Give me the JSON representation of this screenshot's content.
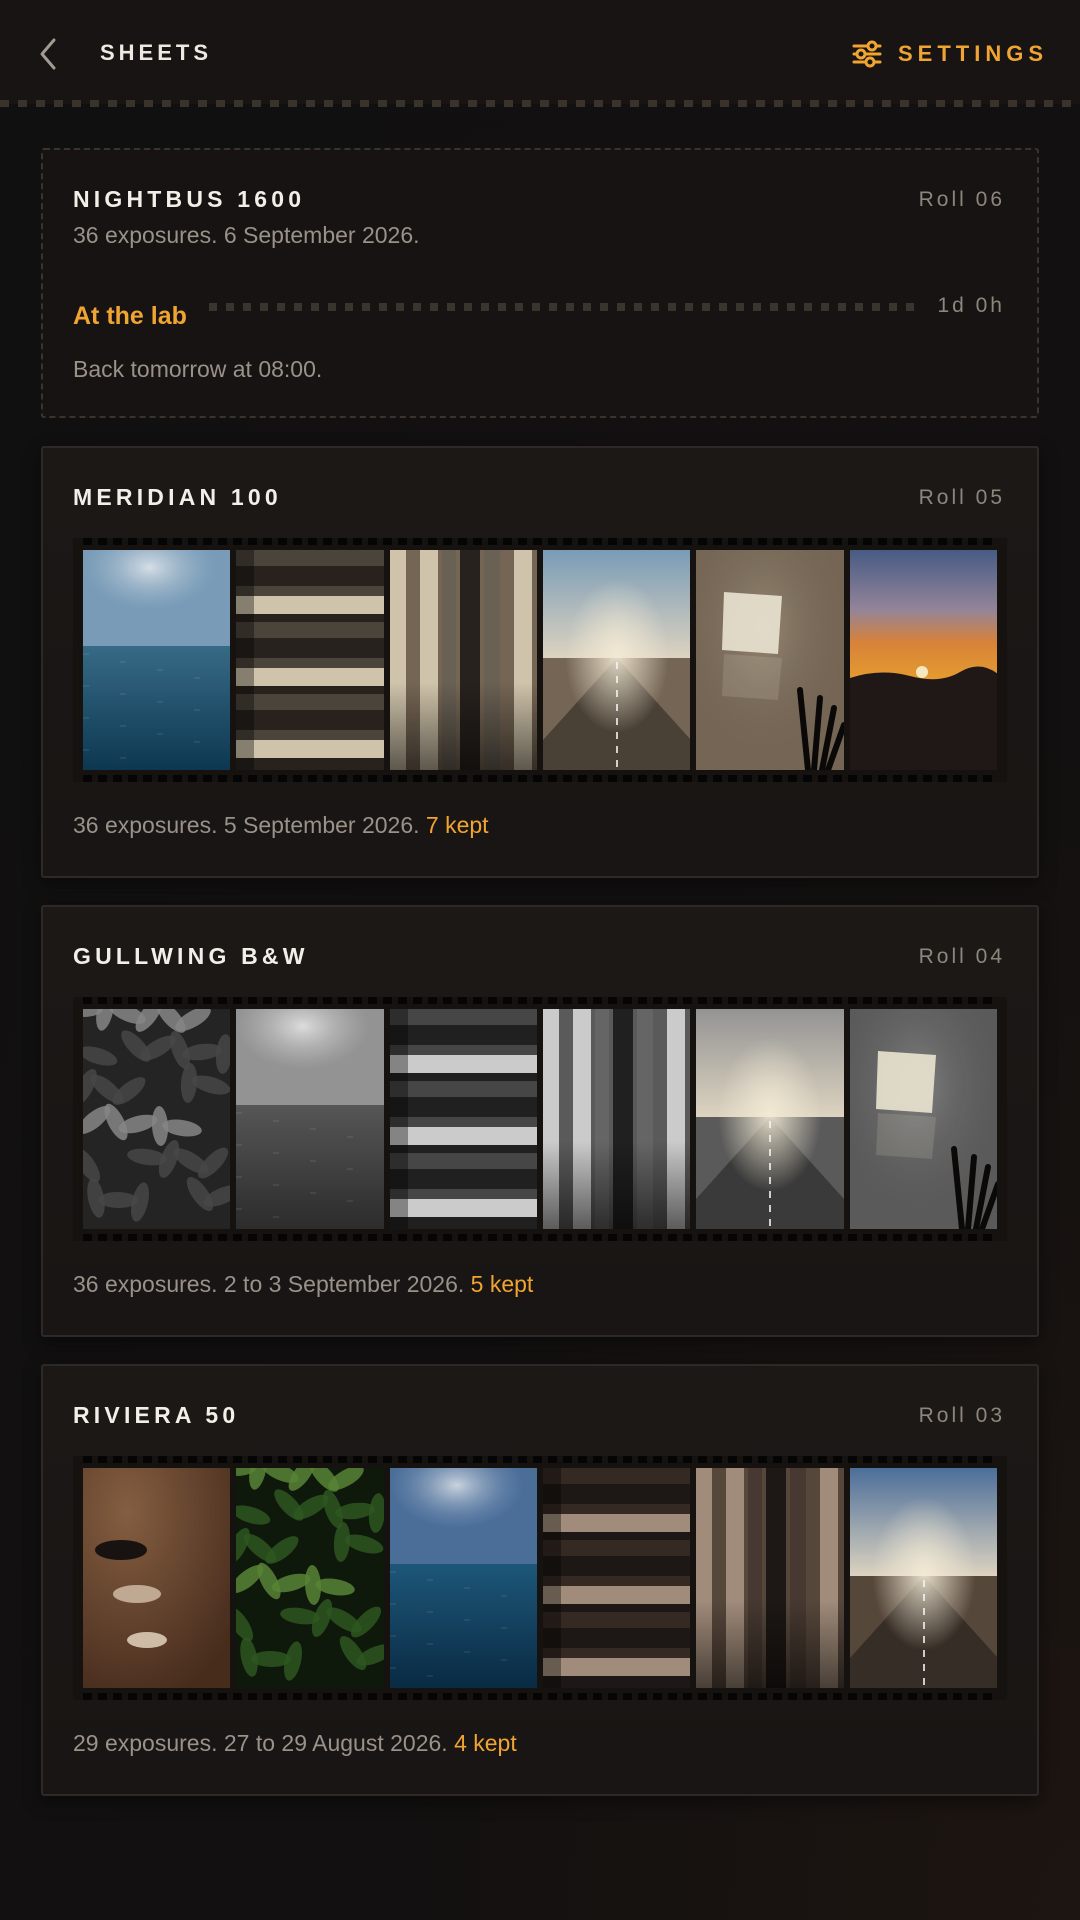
{
  "header": {
    "back_icon": "chevron-left-icon",
    "back_label": "SHEETS",
    "settings_icon": "sliders-icon",
    "settings_label": "SETTINGS",
    "accent_color": "#f0a431"
  },
  "pending_roll": {
    "title": "NIGHTBUS 1600",
    "roll": "Roll 06",
    "meta": "36 exposures. 6 September 2026.",
    "status": "At the lab",
    "eta": "1d 0h",
    "note": "Back tomorrow at 08:00."
  },
  "rolls": [
    {
      "title": "MERIDIAN 100",
      "roll": "Roll 05",
      "meta": "36 exposures. 5 September 2026.",
      "kept": "7 kept",
      "frames": [
        "sea",
        "stripes-h",
        "stripes-v",
        "road",
        "window",
        "sunset"
      ]
    },
    {
      "title": "GULLWING B&W",
      "roll": "Roll 04",
      "meta": "36 exposures. 2 to 3 September 2026.",
      "kept": "5 kept",
      "frames": [
        "leaves",
        "sea",
        "stripes-h",
        "stripes-v",
        "road",
        "window"
      ]
    },
    {
      "title": "RIVIERA 50",
      "roll": "Roll 03",
      "meta": "29 exposures. 27 to 29 August 2026.",
      "kept": "4 kept",
      "frames": [
        "stones",
        "leaves",
        "sea",
        "stripes-h",
        "stripes-v",
        "road"
      ]
    }
  ]
}
